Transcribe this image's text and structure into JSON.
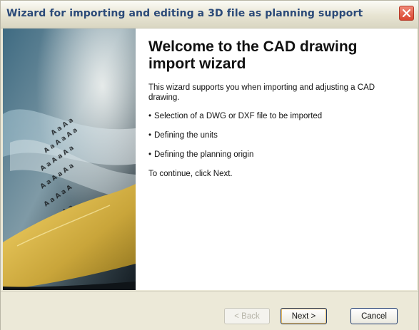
{
  "window": {
    "title": "Wizard for importing and editing a 3D file as planning support"
  },
  "sidebar": {
    "image": "stylized-3d-lettered-sheet-illustration"
  },
  "main": {
    "heading": "Welcome to the CAD drawing import wizard",
    "intro": "This wizard supports you when importing and adjusting a CAD drawing.",
    "bullets": [
      "Selection of a DWG or DXF file to be imported",
      "Defining the units",
      "Defining the planning origin"
    ],
    "continue_text": "To continue, click Next."
  },
  "buttons": {
    "back": "< Back",
    "next": "Next >",
    "cancel": "Cancel"
  },
  "colors": {
    "title_text": "#2b4a78",
    "close_button": "#d9452f",
    "dialog_bg": "#ece9d8"
  }
}
